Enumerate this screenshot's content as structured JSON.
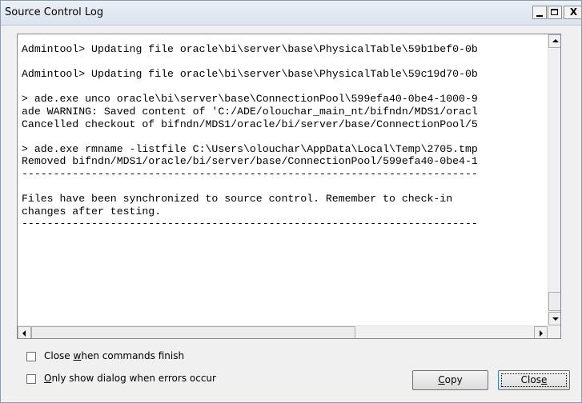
{
  "window": {
    "title": "Source Control Log",
    "minimize_label": "_",
    "close_label": "X"
  },
  "log": {
    "lines": [
      "Admintool> Updating file oracle\\bi\\server\\base\\PhysicalTable\\59b1bef0-0b",
      "",
      "Admintool> Updating file oracle\\bi\\server\\base\\PhysicalTable\\59c19d70-0b",
      "",
      "> ade.exe unco oracle\\bi\\server\\base\\ConnectionPool\\599efa40-0be4-1000-9",
      "ade WARNING: Saved content of 'C:/ADE/olouchar_main_nt/bifndn/MDS1/oracl",
      "Cancelled checkout of bifndn/MDS1/oracle/bi/server/base/ConnectionPool/5",
      "",
      "> ade.exe rmname -listfile C:\\Users\\olouchar\\AppData\\Local\\Temp\\2705.tmp",
      "Removed bifndn/MDS1/oracle/bi/server/base/ConnectionPool/599efa40-0be4-1",
      "------------------------------------------------------------------------",
      "",
      "Files have been synchronized to source control. Remember to check-in",
      "changes after testing.",
      "------------------------------------------------------------------------"
    ]
  },
  "options": {
    "close_when_finish": {
      "label_pre": "Close ",
      "label_accel": "w",
      "label_post": "hen commands finish",
      "checked": false
    },
    "only_show_errors": {
      "label_pre": "",
      "label_accel": "O",
      "label_post": "nly show dialog when errors occur",
      "checked": false
    }
  },
  "buttons": {
    "copy": {
      "label_pre": "",
      "label_accel": "C",
      "label_post": "opy"
    },
    "close": {
      "label_pre": "Clos",
      "label_accel": "e",
      "label_post": ""
    }
  }
}
